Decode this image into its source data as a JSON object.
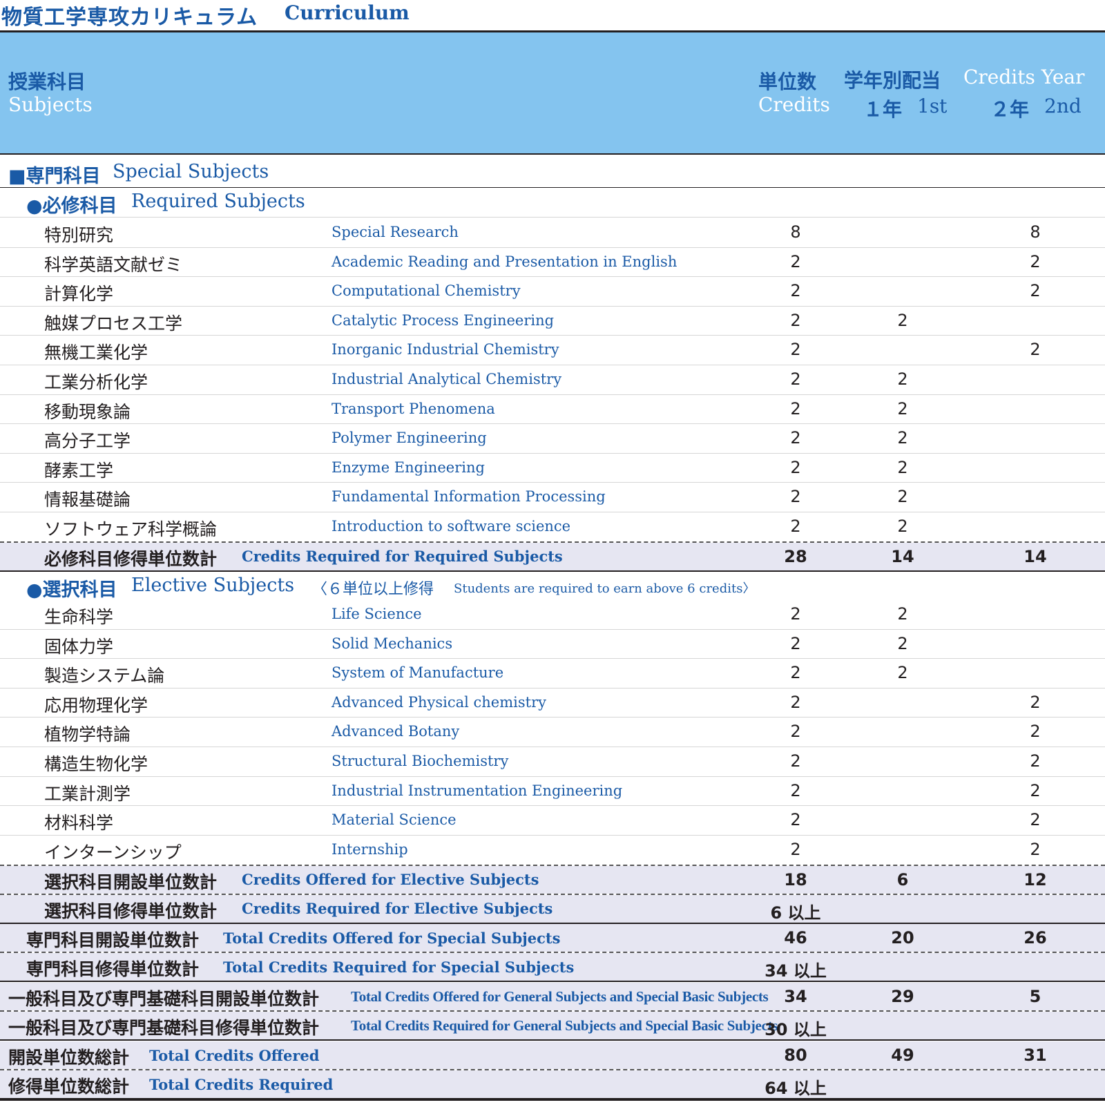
{
  "title": {
    "jp": "物質工学専攻カリキュラム",
    "en": "Curriculum"
  },
  "header": {
    "subjects_jp": "授業科目",
    "subjects_en": "Subjects",
    "credits_jp": "単位数",
    "credits_en": "Credits",
    "year_jp": "学年別配当",
    "year_en": "Credits Year",
    "year1": "１年",
    "year1_en": "1st",
    "year2": "２年",
    "year2_en": "2nd"
  },
  "special": {
    "jp": "■専門科目",
    "en": "Special Subjects"
  },
  "required": {
    "jp": "●必修科目",
    "en": "Required Subjects",
    "rows": [
      {
        "jp": "特別研究",
        "en": "Special Research",
        "credits": "8",
        "y1": "",
        "y2": "8"
      },
      {
        "jp": "科学英語文献ゼミ",
        "en": "Academic Reading and Presentation in English",
        "credits": "2",
        "y1": "",
        "y2": "2"
      },
      {
        "jp": "計算化学",
        "en": "Computational Chemistry",
        "credits": "2",
        "y1": "",
        "y2": "2"
      },
      {
        "jp": "触媒プロセス工学",
        "en": "Catalytic Process Engineering",
        "credits": "2",
        "y1": "2",
        "y2": ""
      },
      {
        "jp": "無機工業化学",
        "en": "Inorganic Industrial Chemistry",
        "credits": "2",
        "y1": "",
        "y2": "2"
      },
      {
        "jp": "工業分析化学",
        "en": "Industrial Analytical Chemistry",
        "credits": "2",
        "y1": "2",
        "y2": ""
      },
      {
        "jp": "移動現象論",
        "en": "Transport Phenomena",
        "credits": "2",
        "y1": "2",
        "y2": ""
      },
      {
        "jp": "高分子工学",
        "en": "Polymer Engineering",
        "credits": "2",
        "y1": "2",
        "y2": ""
      },
      {
        "jp": "酵素工学",
        "en": "Enzyme Engineering",
        "credits": "2",
        "y1": "2",
        "y2": ""
      },
      {
        "jp": "情報基礎論",
        "en": "Fundamental Information Processing",
        "credits": "2",
        "y1": "2",
        "y2": ""
      },
      {
        "jp": "ソフトウェア科学概論",
        "en": "Introduction to software science",
        "credits": "2",
        "y1": "2",
        "y2": ""
      }
    ],
    "total": {
      "jp": "必修科目修得単位数計",
      "en": "Credits Required for Required Subjects",
      "credits": "28",
      "y1": "14",
      "y2": "14"
    }
  },
  "elective": {
    "jp": "●選択科目",
    "en": "Elective Subjects",
    "note_jp": "〈６単位以上修得",
    "note_en": "Students are required to earn above 6 credits〉",
    "rows": [
      {
        "jp": "生命科学",
        "en": "Life Science",
        "credits": "2",
        "y1": "2",
        "y2": ""
      },
      {
        "jp": "固体力学",
        "en": "Solid Mechanics",
        "credits": "2",
        "y1": "2",
        "y2": ""
      },
      {
        "jp": "製造システム論",
        "en": "System of Manufacture",
        "credits": "2",
        "y1": "2",
        "y2": ""
      },
      {
        "jp": "応用物理化学",
        "en": "Advanced Physical chemistry",
        "credits": "2",
        "y1": "",
        "y2": "2"
      },
      {
        "jp": "植物学特論",
        "en": "Advanced Botany",
        "credits": "2",
        "y1": "",
        "y2": "2"
      },
      {
        "jp": "構造生物化学",
        "en": "Structural Biochemistry",
        "credits": "2",
        "y1": "",
        "y2": "2"
      },
      {
        "jp": "工業計測学",
        "en": "Industrial Instrumentation Engineering",
        "credits": "2",
        "y1": "",
        "y2": "2"
      },
      {
        "jp": "材料科学",
        "en": "Material Science",
        "credits": "2",
        "y1": "",
        "y2": "2"
      },
      {
        "jp": "インターンシップ",
        "en": "Internship",
        "credits": "2",
        "y1": "",
        "y2": "2"
      }
    ],
    "offered": {
      "jp": "選択科目開設単位数計",
      "en": "Credits Offered for Elective Subjects",
      "credits": "18",
      "y1": "6",
      "y2": "12"
    },
    "required": {
      "jp": "選択科目修得単位数計",
      "en": "Credits Required for Elective Subjects",
      "credits": "6 以上"
    }
  },
  "totals": [
    {
      "jp": "専門科目開設単位数計",
      "en": "Total Credits Offered for Special Subjects",
      "credits": "46",
      "y1": "20",
      "y2": "26"
    },
    {
      "jp": "専門科目修得単位数計",
      "en": "Total Credits Required for Special Subjects",
      "credits": "34 以上",
      "y1": "",
      "y2": ""
    },
    {
      "jp": "一般科目及び専門基礎科目開設単位数計",
      "en": "Total Credits Offered for General Subjects and Special Basic Subjects",
      "credits": "34",
      "y1": "29",
      "y2": "5"
    },
    {
      "jp": "一般科目及び専門基礎科目修得単位数計",
      "en": "Total Credits Required for General Subjects and Special Basic Subjects",
      "credits": "30 以上",
      "y1": "",
      "y2": ""
    },
    {
      "jp": "開設単位数総計",
      "en": "Total Credits Offered",
      "credits": "80",
      "y1": "49",
      "y2": "31"
    },
    {
      "jp": "修得単位数総計",
      "en": "Total Credits Required",
      "credits": "64 以上",
      "y1": "",
      "y2": ""
    }
  ],
  "colors": {
    "header_bg": "#84c4ef",
    "accent": "#1a5aa6",
    "summary_bg": "#e6e6f2"
  }
}
